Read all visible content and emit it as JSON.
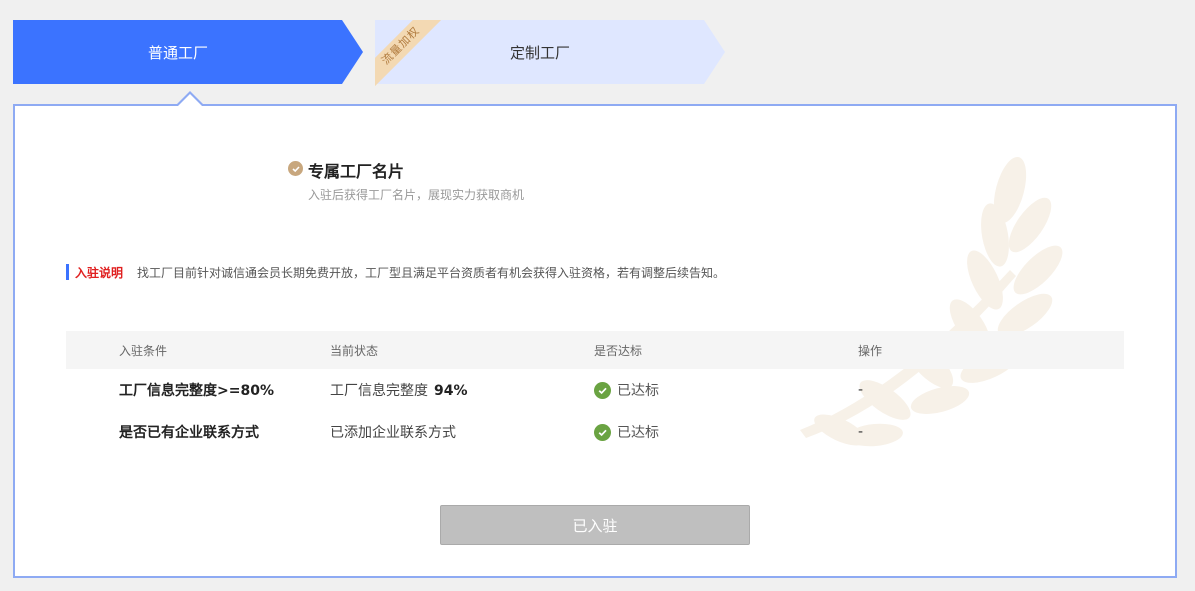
{
  "tabs": [
    {
      "label": "普通工厂",
      "active": true
    },
    {
      "label": "定制工厂",
      "active": false,
      "ribbon": "流量加权"
    }
  ],
  "feature": {
    "title": "专属工厂名片",
    "subtitle": "入驻后获得工厂名片，展现实力获取商机"
  },
  "notice": {
    "label": "入驻说明",
    "text": "找工厂目前针对诚信通会员长期免费开放，工厂型且满足平台资质者有机会获得入驻资格，若有调整后续告知。"
  },
  "table": {
    "headers": [
      "入驻条件",
      "当前状态",
      "是否达标",
      "操作"
    ],
    "rows": [
      {
        "condition": "工厂信息完整度>=80%",
        "state": "工厂信息完整度",
        "state_value": "94%",
        "met": "已达标",
        "action": "-"
      },
      {
        "condition": "是否已有企业联系方式",
        "state": "已添加企业联系方式",
        "state_value": "",
        "met": "已达标",
        "action": "-"
      }
    ]
  },
  "button": {
    "label": "已入驻"
  },
  "colors": {
    "accent": "#3b73ff",
    "tab_inactive": "#dfe7ff",
    "panel_border": "#8eaaf3",
    "success": "#6aa342",
    "notice_red": "#e02020",
    "feature_gold": "#c8a77e"
  }
}
